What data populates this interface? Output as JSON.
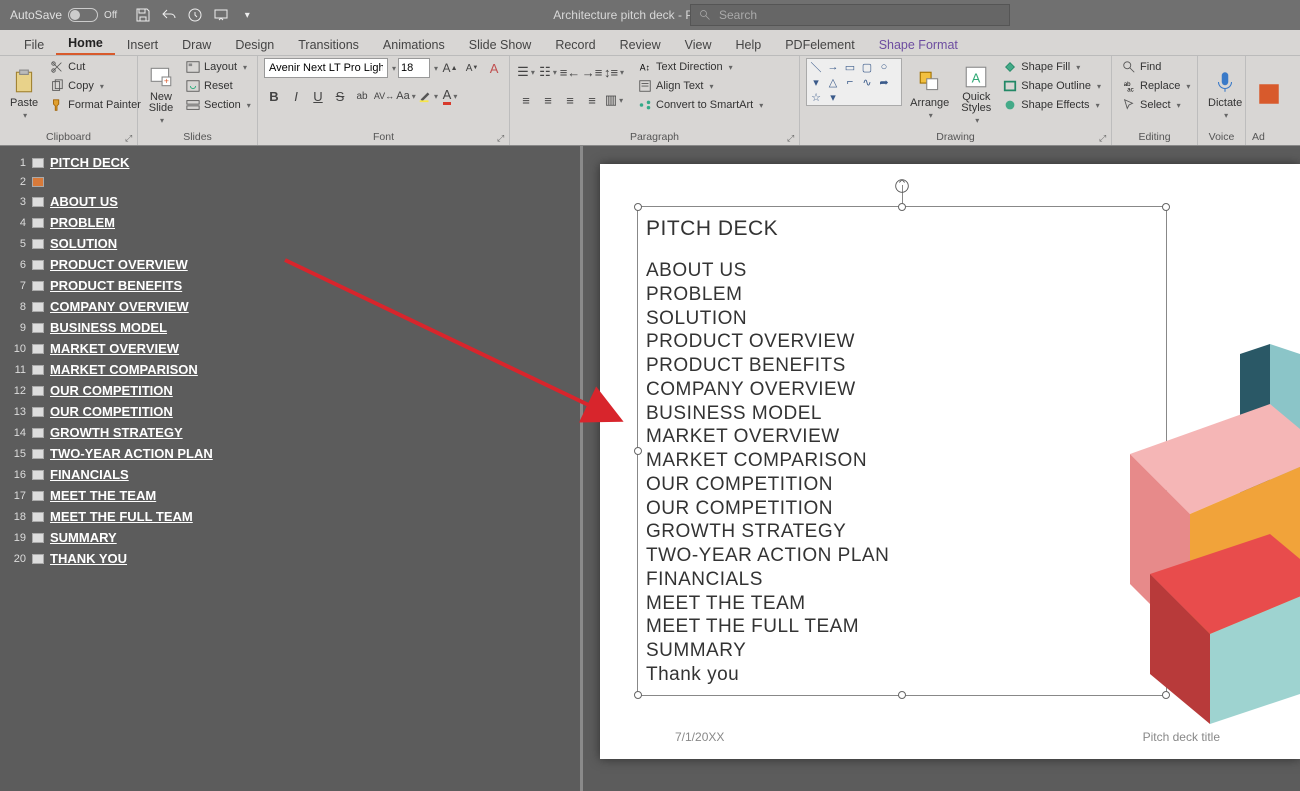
{
  "titlebar": {
    "autosave_label": "AutoSave",
    "autosave_state": "Off",
    "doc_title": "Architecture pitch deck  -  PowerPoint",
    "search_placeholder": "Search"
  },
  "tabs": [
    "File",
    "Home",
    "Insert",
    "Draw",
    "Design",
    "Transitions",
    "Animations",
    "Slide Show",
    "Record",
    "Review",
    "View",
    "Help",
    "PDFelement",
    "Shape Format"
  ],
  "active_tab": "Home",
  "ribbon": {
    "clipboard": {
      "paste": "Paste",
      "cut": "Cut",
      "copy": "Copy",
      "format_painter": "Format Painter",
      "label": "Clipboard"
    },
    "slides": {
      "new_slide": "New\nSlide",
      "layout": "Layout",
      "reset": "Reset",
      "section": "Section",
      "label": "Slides"
    },
    "font": {
      "name": "Avenir Next LT Pro Light (",
      "size": "18",
      "label": "Font"
    },
    "paragraph": {
      "text_direction": "Text Direction",
      "align_text": "Align Text",
      "convert_smartart": "Convert to SmartArt",
      "label": "Paragraph"
    },
    "drawing": {
      "arrange": "Arrange",
      "quick_styles": "Quick\nStyles",
      "shape_fill": "Shape Fill",
      "shape_outline": "Shape Outline",
      "shape_effects": "Shape Effects",
      "label": "Drawing"
    },
    "editing": {
      "find": "Find",
      "replace": "Replace",
      "select": "Select",
      "label": "Editing"
    },
    "voice": {
      "dictate": "Dictate",
      "label": "Voice"
    },
    "addins": {
      "label": "Ad"
    }
  },
  "outline": [
    {
      "n": "1",
      "title": "PITCH DECK"
    },
    {
      "n": "2",
      "title": ""
    },
    {
      "n": "3",
      "title": "ABOUT US"
    },
    {
      "n": "4",
      "title": "PROBLEM"
    },
    {
      "n": "5",
      "title": "SOLUTION"
    },
    {
      "n": "6",
      "title": "PRODUCT OVERVIEW"
    },
    {
      "n": "7",
      "title": "PRODUCT BENEFITS"
    },
    {
      "n": "8",
      "title": "COMPANY OVERVIEW"
    },
    {
      "n": "9",
      "title": "BUSINESS MODEL"
    },
    {
      "n": "10",
      "title": "MARKET OVERVIEW"
    },
    {
      "n": "11",
      "title": "MARKET COMPARISON"
    },
    {
      "n": "12",
      "title": "OUR COMPETITION"
    },
    {
      "n": "13",
      "title": "OUR COMPETITION"
    },
    {
      "n": "14",
      "title": "GROWTH STRATEGY"
    },
    {
      "n": "15",
      "title": "TWO-YEAR ACTION PLAN"
    },
    {
      "n": "16",
      "title": "FINANCIALS"
    },
    {
      "n": "17",
      "title": "MEET THE TEAM"
    },
    {
      "n": "18",
      "title": "MEET THE FULL TEAM"
    },
    {
      "n": "19",
      "title": "SUMMARY"
    },
    {
      "n": "20",
      "title": "THANK YOU"
    }
  ],
  "slide": {
    "title": "PITCH DECK",
    "lines": [
      "ABOUT US",
      "PROBLEM",
      "SOLUTION",
      "PRODUCT OVERVIEW",
      "PRODUCT BENEFITS",
      "COMPANY OVERVIEW",
      "BUSINESS MODEL",
      "MARKET OVERVIEW",
      "MARKET COMPARISON",
      "OUR COMPETITION",
      "OUR COMPETITION",
      "GROWTH STRATEGY",
      "TWO-YEAR ACTION PLAN",
      "FINANCIALS",
      "MEET THE TEAM",
      "MEET THE FULL TEAM",
      "SUMMARY",
      "Thank you"
    ],
    "footer_date": "7/1/20XX",
    "footer_title": "Pitch deck title"
  }
}
